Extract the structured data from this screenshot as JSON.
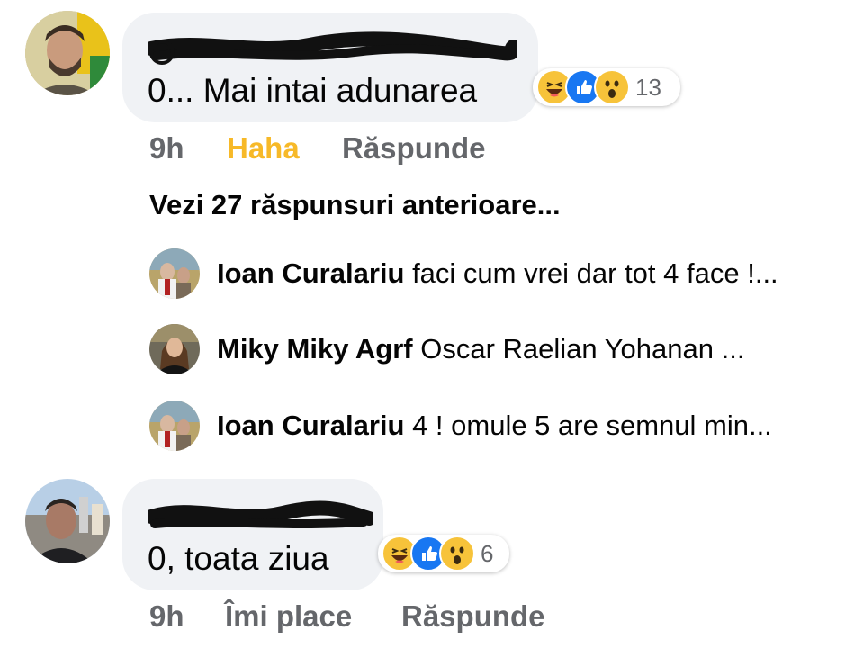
{
  "comments": [
    {
      "text": "0... Mai intai adunarea",
      "time": "9h",
      "like_label": "Haha",
      "reply_label": "Răspunde",
      "reaction_count": "13"
    },
    {
      "text": "0, toata ziua",
      "time": "9h",
      "like_label": "Îmi place",
      "reply_label": "Răspunde",
      "reaction_count": "6"
    }
  ],
  "view_more_replies": "Vezi 27 răspunsuri anterioare...",
  "replies": [
    {
      "name": "Ioan Curalariu",
      "text": "faci cum vrei dar tot 4 face !..."
    },
    {
      "name": "Miky Miky Agrf",
      "text": "Oscar Raelian Yohanan ..."
    },
    {
      "name": "Ioan Curalariu",
      "text": "4 ! omule   5 are semnul min..."
    }
  ],
  "colors": {
    "bubble": "#f0f2f5",
    "haha_active": "#f7b928",
    "secondary_text": "#65676b",
    "like_blue": "#1877f2"
  }
}
